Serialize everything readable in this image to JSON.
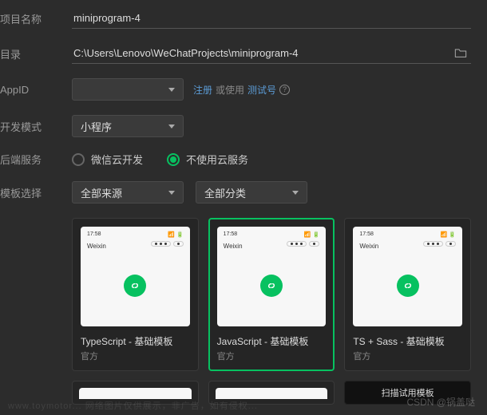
{
  "form": {
    "project_name": {
      "label": "项目名称",
      "value": "miniprogram-4"
    },
    "directory": {
      "label": "目录",
      "value": "C:\\Users\\Lenovo\\WeChatProjects\\miniprogram-4"
    },
    "appid": {
      "label": "AppID",
      "value": "",
      "register_link": "注册",
      "or_use": "或使用",
      "test_link": "测试号"
    },
    "dev_mode": {
      "label": "开发模式",
      "value": "小程序"
    },
    "backend": {
      "label": "后端服务",
      "options": [
        "微信云开发",
        "不使用云服务"
      ],
      "selected": 1
    },
    "template": {
      "label": "模板选择",
      "source_filter": "全部来源",
      "category_filter": "全部分类"
    }
  },
  "preview": {
    "time": "17:58",
    "app_name": "Weixin"
  },
  "templates": [
    {
      "name": "TypeScript - 基础模板",
      "author": "官方",
      "selected": false
    },
    {
      "name": "JavaScript - 基础模板",
      "author": "官方",
      "selected": true
    },
    {
      "name": "TS + Sass - 基础模板",
      "author": "官方",
      "selected": false
    }
  ],
  "scan_label": "扫描试用模板",
  "watermark": "CSDN @锅盖哒",
  "bg_watermark": "www.toymotor... 网络图片仅供展示，非广告，如有侵权..."
}
